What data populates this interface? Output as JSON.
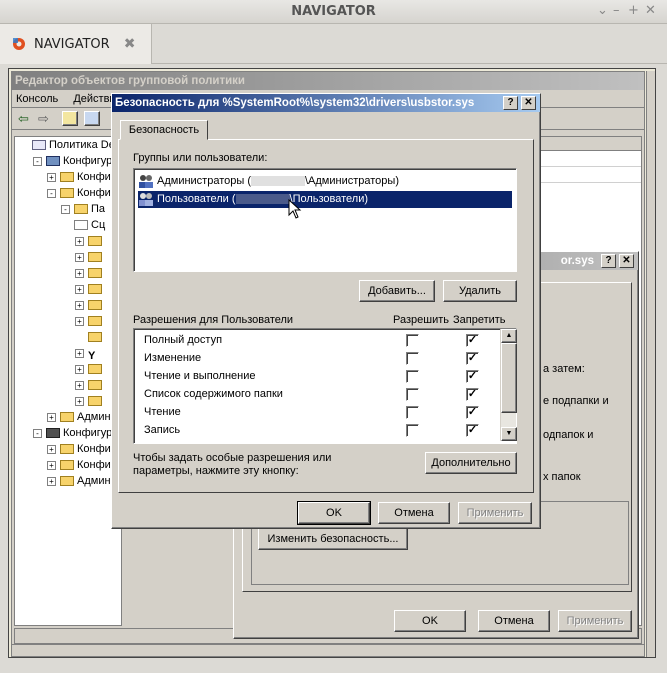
{
  "outer": {
    "title": "NAVIGATOR",
    "tab_label": "NAVIGATOR",
    "tab_close": "✖",
    "controls": [
      "⌄",
      "–",
      "+",
      "✕"
    ]
  },
  "gpedit": {
    "title": "Редактор объектов групповой политики",
    "menu": [
      "Консоль",
      "Действие"
    ],
    "tree": [
      {
        "label": "Политика Default",
        "indent": 0,
        "pm": "",
        "icon": "policy"
      },
      {
        "label": "Конфигурация",
        "indent": 1,
        "pm": "-",
        "icon": "computer"
      },
      {
        "label": "Конфиг",
        "indent": 2,
        "pm": "+",
        "icon": "folder"
      },
      {
        "label": "Конфиг",
        "indent": 2,
        "pm": "-",
        "icon": "folder"
      },
      {
        "label": "Па",
        "indent": 3,
        "pm": "-",
        "icon": "folder"
      },
      {
        "label": "Сц",
        "indent": 3,
        "pm": "",
        "icon": "doc"
      },
      {
        "label": "",
        "indent": 4,
        "pm": "+",
        "icon": "folder"
      },
      {
        "label": "",
        "indent": 4,
        "pm": "+",
        "icon": "folder"
      },
      {
        "label": "",
        "indent": 4,
        "pm": "+",
        "icon": "folder"
      },
      {
        "label": "",
        "indent": 4,
        "pm": "+",
        "icon": "folder"
      },
      {
        "label": "",
        "indent": 4,
        "pm": "+",
        "icon": "folder"
      },
      {
        "label": "",
        "indent": 4,
        "pm": "+",
        "icon": "folder"
      },
      {
        "label": "",
        "indent": 4,
        "pm": "",
        "icon": "folder"
      },
      {
        "label": "",
        "indent": 4,
        "pm": "+",
        "icon": "antenna"
      },
      {
        "label": "",
        "indent": 4,
        "pm": "+",
        "icon": "folder"
      },
      {
        "label": "",
        "indent": 4,
        "pm": "+",
        "icon": "folder"
      },
      {
        "label": "",
        "indent": 4,
        "pm": "+",
        "icon": "folder"
      },
      {
        "label": "Админ",
        "indent": 2,
        "pm": "+",
        "icon": "folder"
      },
      {
        "label": "Конфигура",
        "indent": 1,
        "pm": "-",
        "icon": "user"
      },
      {
        "label": "Конфи",
        "indent": 2,
        "pm": "+",
        "icon": "folder"
      },
      {
        "label": "Конфи",
        "indent": 2,
        "pm": "+",
        "icon": "folder"
      },
      {
        "label": "Админ",
        "indent": 2,
        "pm": "+",
        "icon": "folder"
      }
    ]
  },
  "back_dialog": {
    "title_suffix": "or.sys",
    "text_lines": [
      "а затем:",
      "е подпапки и",
      "одпапок и",
      "х папок"
    ],
    "change_security": "Изменить безопасность...",
    "ok": "OK",
    "cancel": "Отмена",
    "apply": "Применить"
  },
  "security_dialog": {
    "title": "Безопасность для %SystemRoot%\\system32\\drivers\\usbstor.sys",
    "help_btn": "?",
    "close_btn": "✕",
    "tab": "Безопасность",
    "groups_label": "Группы или пользователи:",
    "users": [
      {
        "name_prefix": "Администраторы (",
        "name_suffix": "\\Администраторы)",
        "selected": false
      },
      {
        "name_prefix": "Пользователи (",
        "name_suffix": "\\Пользователи)",
        "selected": true
      }
    ],
    "add_btn": "Добавить...",
    "remove_btn": "Удалить",
    "perm_label": "Разрешения для Пользователи",
    "allow_col": "Разрешить",
    "deny_col": "Запретить",
    "permissions": [
      {
        "name": "Полный доступ",
        "allow": false,
        "deny": true
      },
      {
        "name": "Изменение",
        "allow": false,
        "deny": true
      },
      {
        "name": "Чтение и выполнение",
        "allow": false,
        "deny": true
      },
      {
        "name": "Список содержимого папки",
        "allow": false,
        "deny": true
      },
      {
        "name": "Чтение",
        "allow": false,
        "deny": true
      },
      {
        "name": "Запись",
        "allow": false,
        "deny": true
      }
    ],
    "advanced_hint": "Чтобы задать особые разрешения или параметры, нажмите эту кнопку:",
    "advanced_btn": "Дополнительно",
    "ok": "OK",
    "cancel": "Отмена",
    "apply": "Применить"
  }
}
